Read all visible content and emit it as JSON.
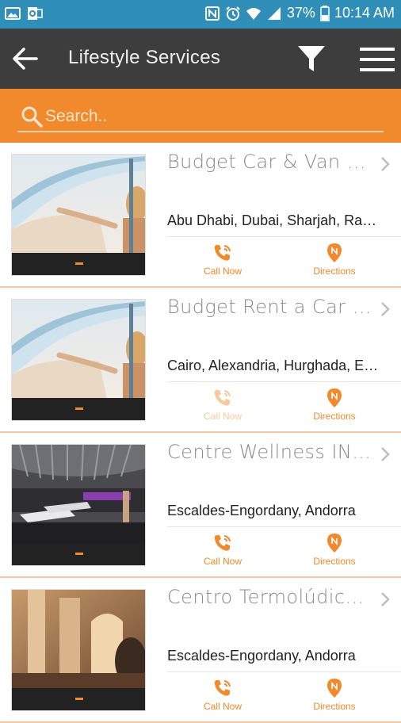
{
  "status_bar": {
    "battery": "37%",
    "time": "10:14 AM",
    "icons": [
      "image-icon",
      "outlook-icon",
      "nfc-icon",
      "alarm-icon",
      "wifi-icon",
      "signal-icon",
      "battery-icon"
    ]
  },
  "app_bar": {
    "title": "Lifestyle Services",
    "icons": [
      "back-arrow-icon",
      "filter-icon",
      "hamburger-menu-icon"
    ]
  },
  "search": {
    "placeholder": "Search.."
  },
  "colors": {
    "status_bar": "#2f8fb8",
    "app_bar": "#3d3d3d",
    "accent": "#f08a2c"
  },
  "listings": [
    {
      "name": "Budget Car & Van Rental",
      "location": "Abu Dhabi, Dubai, Sharjah, Ras Al Khaimah",
      "call_label": "Call Now",
      "directions_label": "Directions",
      "call_enabled": true,
      "image": "convertible-car-photo"
    },
    {
      "name": "Budget Rent a Car Egypt",
      "location": "Cairo, Alexandria, Hurghada, Egypt",
      "call_label": "Call Now",
      "directions_label": "Directions",
      "call_enabled": false,
      "image": "convertible-car-photo"
    },
    {
      "name": "Centre Wellness INÚU",
      "location": "Escaldes-Engordany, Andorra",
      "call_label": "Call Now",
      "directions_label": "Directions",
      "call_enabled": true,
      "image": "spa-lounge-photo"
    },
    {
      "name": "Centro Termolúdico Caldea",
      "location": "Escaldes-Engordany, Andorra",
      "call_label": "Call Now",
      "directions_label": "Directions",
      "call_enabled": true,
      "image": "thermal-bath-photo"
    }
  ]
}
